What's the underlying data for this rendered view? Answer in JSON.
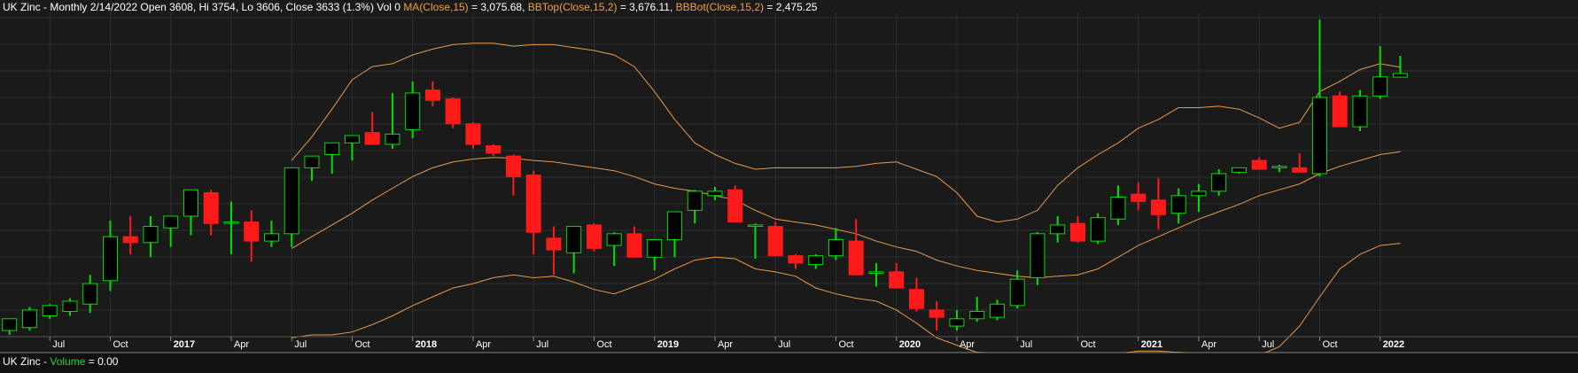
{
  "header": {
    "symbol": "UK Zinc",
    "info": "- Monthly 2/14/2022 Open 3608, Hi 3754, Lo 3606, Close 3633 (1.3%) Vol 0",
    "ma_label": "MA(Close,15)",
    "ma_value": "= 3,075.68,",
    "bbtop_label": "BBTop(Close,15,2)",
    "bbtop_value": "= 3,676.11,",
    "bbbot_label": "BBBot(Close,15,2)",
    "bbbot_value": "= 2,475.25"
  },
  "volume_panel": {
    "symbol": "UK Zinc",
    "label": "Volume",
    "value": "= 0.00"
  },
  "colors": {
    "up": "#00e000",
    "down": "#ff1a1a",
    "bands": "#e89a4c",
    "grid": "#2e2e2e",
    "axis_text": "#ffffff"
  },
  "chart_data": {
    "type": "candlestick",
    "x_tick_labels": [
      "Jul",
      "Oct",
      "2017",
      "Apr",
      "Jul",
      "Oct",
      "2018",
      "Apr",
      "Jul",
      "Oct",
      "2019",
      "Apr",
      "Jul",
      "Oct",
      "2020",
      "Apr",
      "Jul",
      "Oct",
      "2021",
      "Apr",
      "Jul",
      "Oct",
      "2022"
    ],
    "bold_ticks": [
      "2017",
      "2018",
      "2019",
      "2020",
      "2021",
      "2022"
    ],
    "tick_months": [
      "2016-07",
      "2016-10",
      "2017-01",
      "2017-04",
      "2017-07",
      "2017-10",
      "2018-01",
      "2018-04",
      "2018-07",
      "2018-10",
      "2019-01",
      "2019-04",
      "2019-07",
      "2019-10",
      "2020-01",
      "2020-04",
      "2020-07",
      "2020-10",
      "2021-01",
      "2021-04",
      "2021-07",
      "2021-10",
      "2022-01"
    ],
    "ylim": [
      1850,
      4050
    ],
    "grid": true,
    "months": [
      "2016-05",
      "2016-06",
      "2016-07",
      "2016-08",
      "2016-09",
      "2016-10",
      "2016-11",
      "2016-12",
      "2017-01",
      "2017-02",
      "2017-03",
      "2017-04",
      "2017-05",
      "2017-06",
      "2017-07",
      "2017-08",
      "2017-09",
      "2017-10",
      "2017-11",
      "2017-12",
      "2018-01",
      "2018-02",
      "2018-03",
      "2018-04",
      "2018-05",
      "2018-06",
      "2018-07",
      "2018-08",
      "2018-09",
      "2018-10",
      "2018-11",
      "2018-12",
      "2019-01",
      "2019-02",
      "2019-03",
      "2019-04",
      "2019-05",
      "2019-06",
      "2019-07",
      "2019-08",
      "2019-09",
      "2019-10",
      "2019-11",
      "2019-12",
      "2020-01",
      "2020-02",
      "2020-03",
      "2020-04",
      "2020-05",
      "2020-06",
      "2020-07",
      "2020-08",
      "2020-09",
      "2020-10",
      "2020-11",
      "2020-12",
      "2021-01",
      "2021-02",
      "2021-03",
      "2021-04",
      "2021-05",
      "2021-06",
      "2021-07",
      "2021-08",
      "2021-09",
      "2021-10",
      "2021-11",
      "2021-12",
      "2022-01",
      "2022-02"
    ],
    "open": [
      1880,
      1900,
      1980,
      2010,
      2060,
      2220,
      2520,
      2480,
      2580,
      2660,
      2820,
      2620,
      2620,
      2490,
      2540,
      2990,
      3080,
      3160,
      3230,
      3150,
      3250,
      3520,
      3460,
      3290,
      3140,
      3070,
      2940,
      2510,
      2410,
      2600,
      2460,
      2540,
      2380,
      2500,
      2700,
      2800,
      2840,
      2590,
      2590,
      2390,
      2330,
      2390,
      2490,
      2270,
      2280,
      2160,
      2020,
      1910,
      1960,
      1970,
      2050,
      2240,
      2540,
      2610,
      2490,
      2640,
      2810,
      2770,
      2680,
      2800,
      2830,
      2960,
      3040,
      2990,
      2990,
      2950,
      3480,
      3270,
      3480,
      3608
    ],
    "high": [
      1960,
      2040,
      2060,
      2100,
      2260,
      2630,
      2660,
      2660,
      2640,
      2780,
      2840,
      2760,
      2700,
      2630,
      2700,
      3020,
      3100,
      3200,
      3370,
      3500,
      3580,
      3580,
      3470,
      3300,
      3150,
      3080,
      2970,
      2590,
      2570,
      2610,
      2550,
      2590,
      2500,
      2690,
      2840,
      2860,
      2870,
      2610,
      2620,
      2400,
      2400,
      2580,
      2640,
      2340,
      2340,
      2240,
      2080,
      2020,
      2110,
      2090,
      2290,
      2550,
      2660,
      2660,
      2680,
      2870,
      2890,
      2920,
      2850,
      2880,
      2980,
      2990,
      3060,
      3010,
      3090,
      4000,
      3510,
      3520,
      3820,
      3754
    ],
    "low": [
      1850,
      1880,
      1960,
      1980,
      2000,
      2150,
      2400,
      2380,
      2450,
      2530,
      2530,
      2400,
      2350,
      2450,
      2450,
      2900,
      2950,
      3040,
      3150,
      3120,
      3190,
      3410,
      3260,
      3120,
      3070,
      2800,
      2400,
      2260,
      2270,
      2420,
      2320,
      2440,
      2290,
      2380,
      2610,
      2770,
      2710,
      2370,
      2420,
      2300,
      2300,
      2360,
      2330,
      2180,
      2200,
      2010,
      1880,
      1880,
      1940,
      1950,
      2030,
      2190,
      2480,
      2480,
      2470,
      2600,
      2700,
      2570,
      2610,
      2690,
      2800,
      2950,
      2980,
      2960,
      2970,
      2930,
      3300,
      3240,
      3460,
      3606
    ],
    "close": [
      1960,
      2020,
      2050,
      2080,
      2200,
      2520,
      2480,
      2590,
      2660,
      2840,
      2610,
      2620,
      2490,
      2540,
      2990,
      3070,
      3160,
      3210,
      3150,
      3220,
      3500,
      3450,
      3290,
      3150,
      3090,
      2930,
      2550,
      2430,
      2590,
      2440,
      2540,
      2380,
      2500,
      2690,
      2830,
      2830,
      2620,
      2600,
      2390,
      2340,
      2390,
      2500,
      2260,
      2280,
      2170,
      2030,
      1970,
      1960,
      2010,
      2060,
      2230,
      2540,
      2600,
      2490,
      2650,
      2790,
      2760,
      2670,
      2800,
      2830,
      2950,
      2990,
      2980,
      3000,
      2960,
      3470,
      3270,
      3480,
      3610,
      3633
    ],
    "ma": [
      null,
      null,
      null,
      null,
      null,
      null,
      null,
      null,
      null,
      null,
      null,
      null,
      null,
      null,
      2440,
      2520,
      2600,
      2680,
      2770,
      2850,
      2930,
      2990,
      3030,
      3050,
      3060,
      3055,
      3040,
      3030,
      3010,
      2990,
      2970,
      2930,
      2880,
      2850,
      2830,
      2800,
      2770,
      2700,
      2640,
      2620,
      2600,
      2570,
      2540,
      2490,
      2450,
      2420,
      2360,
      2320,
      2290,
      2270,
      2250,
      2240,
      2250,
      2260,
      2300,
      2380,
      2460,
      2520,
      2580,
      2640,
      2690,
      2740,
      2800,
      2840,
      2880,
      2950,
      3000,
      3040,
      3080,
      3100
    ],
    "bb_top": [
      null,
      null,
      null,
      null,
      null,
      null,
      null,
      null,
      null,
      null,
      null,
      null,
      null,
      null,
      3040,
      3200,
      3390,
      3590,
      3680,
      3700,
      3760,
      3800,
      3830,
      3840,
      3840,
      3820,
      3830,
      3830,
      3810,
      3790,
      3760,
      3680,
      3510,
      3320,
      3160,
      3080,
      3020,
      2980,
      2990,
      2990,
      2990,
      2990,
      3000,
      3020,
      3030,
      2980,
      2930,
      2820,
      2660,
      2620,
      2640,
      2700,
      2870,
      2990,
      3080,
      3160,
      3260,
      3320,
      3400,
      3400,
      3410,
      3390,
      3330,
      3260,
      3300,
      3510,
      3580,
      3660,
      3700,
      3676
    ],
    "bb_bot": [
      null,
      null,
      null,
      null,
      null,
      null,
      null,
      null,
      null,
      null,
      null,
      null,
      null,
      null,
      1830,
      1850,
      1850,
      1870,
      1920,
      1980,
      2050,
      2110,
      2170,
      2200,
      2240,
      2260,
      2240,
      2250,
      2210,
      2160,
      2130,
      2180,
      2230,
      2300,
      2360,
      2380,
      2370,
      2300,
      2280,
      2250,
      2170,
      2130,
      2100,
      2080,
      2020,
      1930,
      1830,
      1780,
      1730,
      1720,
      1710,
      1700,
      1700,
      1700,
      1710,
      1720,
      1740,
      1740,
      1730,
      1720,
      1710,
      1710,
      1710,
      1770,
      1910,
      2110,
      2300,
      2400,
      2460,
      2475
    ]
  }
}
